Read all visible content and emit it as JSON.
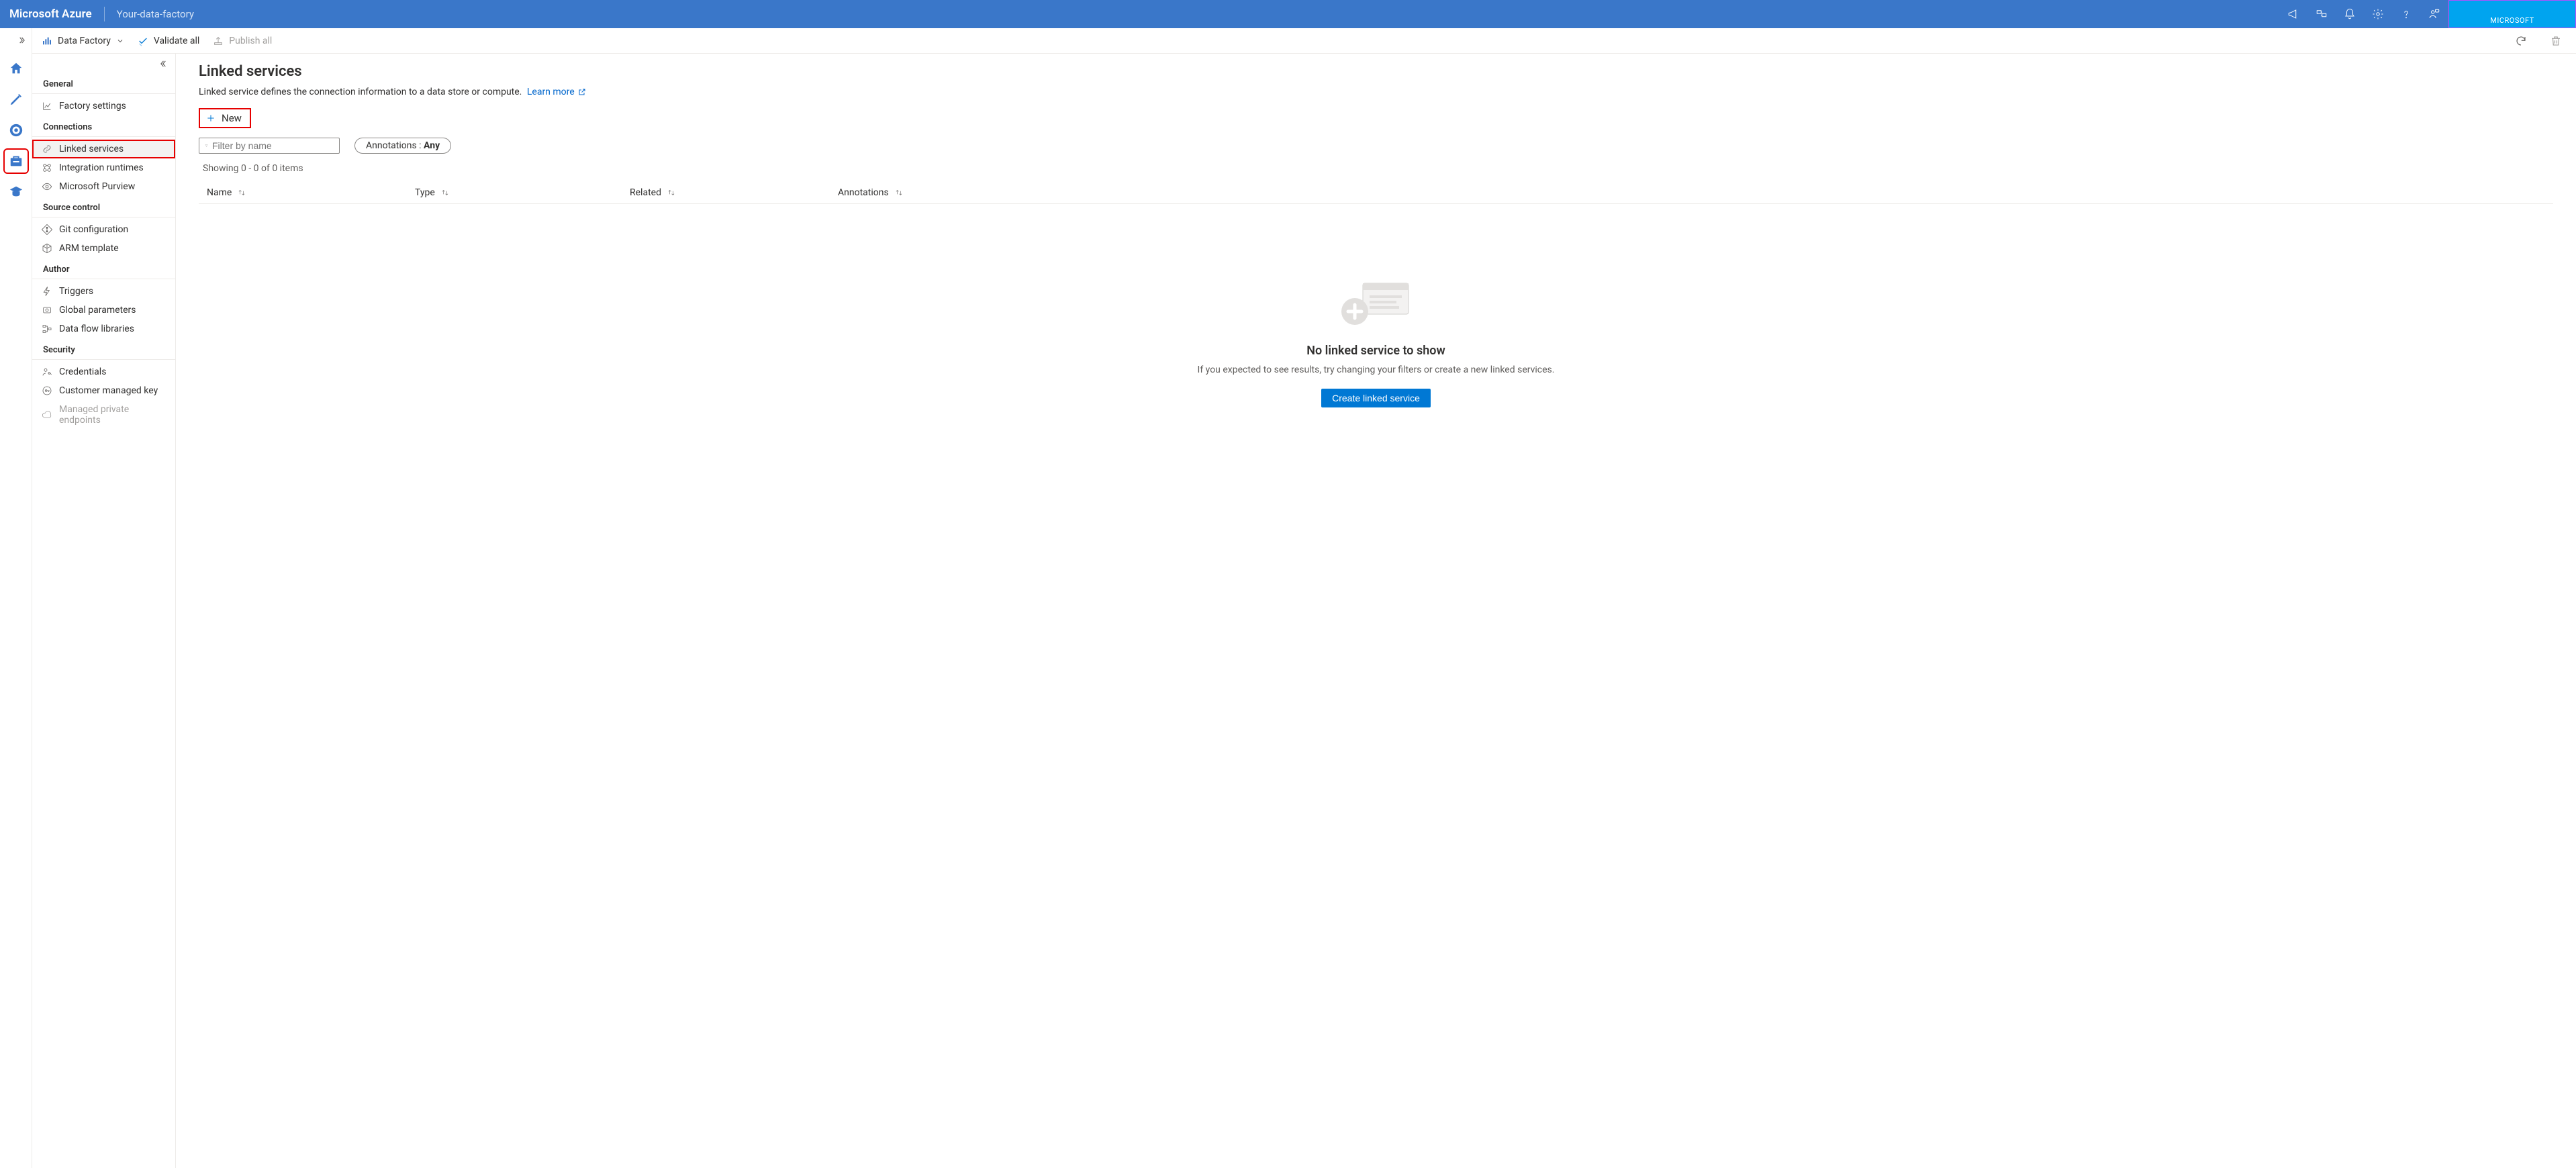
{
  "header": {
    "brand": "Microsoft Azure",
    "subtitle": "Your-data-factory",
    "account_label": "MICROSOFT"
  },
  "cmdbar": {
    "scope_label": "Data Factory",
    "validate_label": "Validate all",
    "publish_label": "Publish all"
  },
  "sidepanel": {
    "sections": [
      {
        "title": "General",
        "items": [
          {
            "label": "Factory settings",
            "icon": "chart-icon"
          }
        ]
      },
      {
        "title": "Connections",
        "items": [
          {
            "label": "Linked services",
            "icon": "link-icon",
            "active": true
          },
          {
            "label": "Integration runtimes",
            "icon": "runtime-icon"
          },
          {
            "label": "Microsoft Purview",
            "icon": "eye-icon"
          }
        ]
      },
      {
        "title": "Source control",
        "items": [
          {
            "label": "Git configuration",
            "icon": "git-icon"
          },
          {
            "label": "ARM template",
            "icon": "cube-icon"
          }
        ]
      },
      {
        "title": "Author",
        "items": [
          {
            "label": "Triggers",
            "icon": "bolt-icon"
          },
          {
            "label": "Global parameters",
            "icon": "param-icon"
          },
          {
            "label": "Data flow libraries",
            "icon": "flow-icon"
          }
        ]
      },
      {
        "title": "Security",
        "items": [
          {
            "label": "Credentials",
            "icon": "person-key-icon"
          },
          {
            "label": "Customer managed key",
            "icon": "key-circle-icon"
          },
          {
            "label": "Managed private endpoints",
            "icon": "cloud-icon",
            "disabled": true
          }
        ]
      }
    ]
  },
  "main": {
    "title": "Linked services",
    "description": "Linked service defines the connection information to a data store or compute.",
    "learn_more": "Learn more",
    "new_button": "New",
    "filter_placeholder": "Filter by name",
    "annotations_label": "Annotations : ",
    "annotations_value": "Any",
    "count_text": "Showing 0 - 0 of 0 items",
    "columns": {
      "name": "Name",
      "type": "Type",
      "related": "Related",
      "annotations": "Annotations"
    },
    "empty": {
      "title": "No linked service to show",
      "subtitle": "If you expected to see results, try changing your filters or create a new linked services.",
      "button": "Create linked service"
    }
  }
}
